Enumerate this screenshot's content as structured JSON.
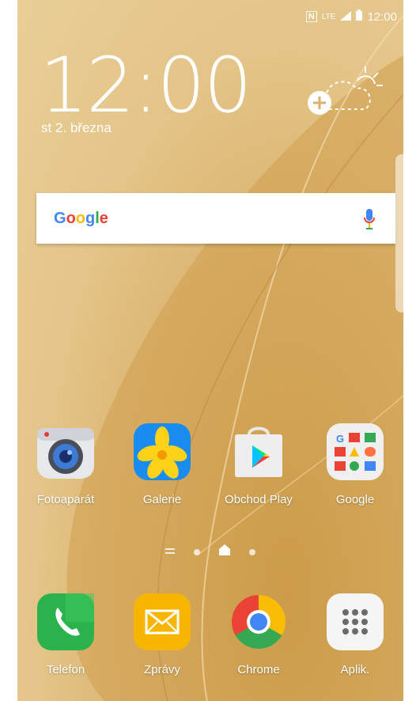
{
  "status_bar": {
    "time": "12:00",
    "nfc": "N",
    "network": "LTE"
  },
  "lock": {
    "time": "12:00",
    "date": "st 2. března"
  },
  "search_widget": {
    "logo": "Google"
  },
  "apps": [
    {
      "label": "Fotoaparát",
      "icon": "camera-icon"
    },
    {
      "label": "Galerie",
      "icon": "gallery-icon"
    },
    {
      "label": "Obchod Play",
      "icon": "play-store-icon"
    },
    {
      "label": "Google",
      "icon": "google-folder-icon"
    }
  ],
  "dock": [
    {
      "label": "Telefon",
      "icon": "phone-icon"
    },
    {
      "label": "Zprávy",
      "icon": "messages-icon"
    },
    {
      "label": "Chrome",
      "icon": "chrome-icon"
    },
    {
      "label": "Aplik.",
      "icon": "apps-grid-icon"
    }
  ],
  "colors": {
    "google_blue": "#4285F4",
    "google_red": "#EA4335",
    "google_yellow": "#FBBC05",
    "google_green": "#34A853",
    "phone_green": "#2bb24c",
    "messages_yellow": "#f7b500"
  }
}
